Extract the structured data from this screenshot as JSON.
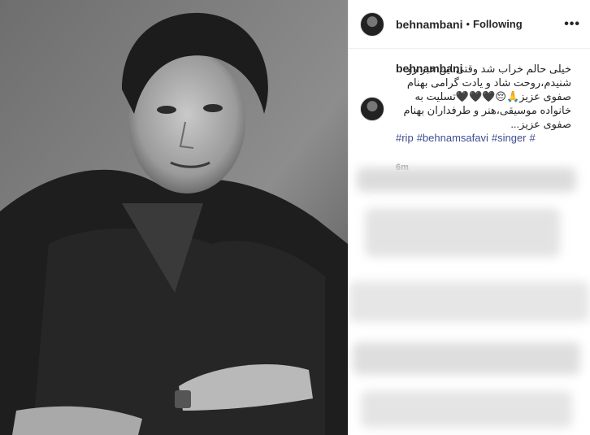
{
  "post": {
    "username": "behnambani",
    "separator": "•",
    "follow_status": "Following",
    "more_label": "•••",
    "caption_text": "خیلی حالم خراب شد وقتی این خبر رو شنیدم،روحت شاد و یادت گرامی بهنام صفوی عزیز🙏😔🖤🖤🖤تسلیت به خانواده موسیقی،هنر و طرفداران بهنام صفوی عزیز...",
    "hashtags": [
      "#rip",
      "#behnamsafavi",
      "#singer",
      "#"
    ],
    "time_ago": "6m"
  },
  "colors": {
    "hashtag": "#3f4d91",
    "muted": "#999999",
    "border": "#efefef"
  },
  "icons": {
    "more": "more-options-icon",
    "avatar": "profile-avatar"
  }
}
